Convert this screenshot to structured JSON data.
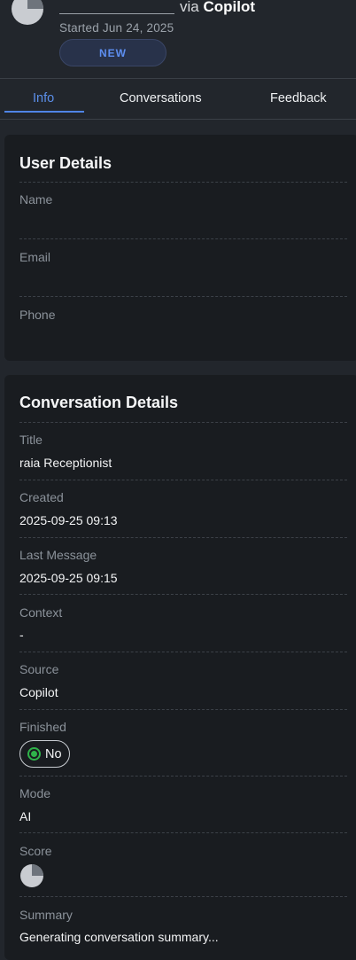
{
  "header": {
    "via_text": "via",
    "channel": "Copilot",
    "started": "Started Jun 24, 2025",
    "badge": "NEW"
  },
  "tabs": [
    "Info",
    "Conversations",
    "Feedback"
  ],
  "user_details": {
    "title": "User Details",
    "fields": [
      {
        "label": "Name",
        "value": ""
      },
      {
        "label": "Email",
        "value": ""
      },
      {
        "label": "Phone",
        "value": ""
      }
    ]
  },
  "conversation_details": {
    "title": "Conversation Details",
    "title_label": "Title",
    "title_value": "raia Receptionist",
    "created_label": "Created",
    "created_value": "2025-09-25 09:13",
    "last_message_label": "Last Message",
    "last_message_value": "2025-09-25 09:15",
    "context_label": "Context",
    "context_value": "-",
    "source_label": "Source",
    "source_value": "Copilot",
    "finished_label": "Finished",
    "finished_value": "No",
    "mode_label": "Mode",
    "mode_value": "AI",
    "score_label": "Score",
    "summary_label": "Summary",
    "summary_value": "Generating conversation summary..."
  },
  "colors": {
    "accent": "#5b8fea",
    "success": "#2fb34a",
    "background": "#22262c",
    "card": "#191c20"
  }
}
